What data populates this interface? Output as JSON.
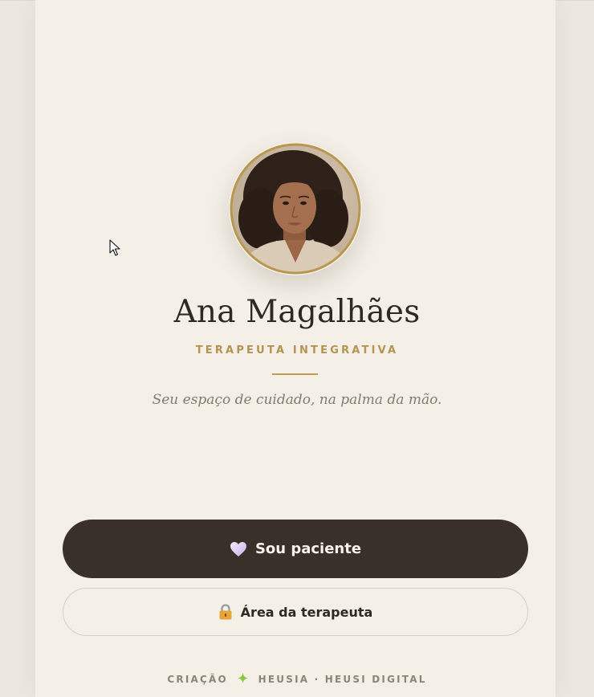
{
  "profile": {
    "name": "Ana Magalhães",
    "role": "TERAPEUTA INTEGRATIVA",
    "tagline": "Seu espaço de cuidado, na palma da mão.",
    "avatar_icon": "profile-photo"
  },
  "actions": {
    "patient": {
      "label": "Sou paciente",
      "icon": "heart-icon"
    },
    "therapist": {
      "label": "Área da terapeuta",
      "icon": "lock-icon"
    }
  },
  "footer": {
    "prefix": "CRIAÇÃO",
    "brand": "HEUSIA",
    "separator": "·",
    "company": "HEUSI DIGITAL",
    "icon": "sparkle-icon"
  },
  "colors": {
    "background": "#f4f0e8",
    "accent_gold": "#b59350",
    "dark": "#383029",
    "sparkle": "#8cc63f"
  }
}
